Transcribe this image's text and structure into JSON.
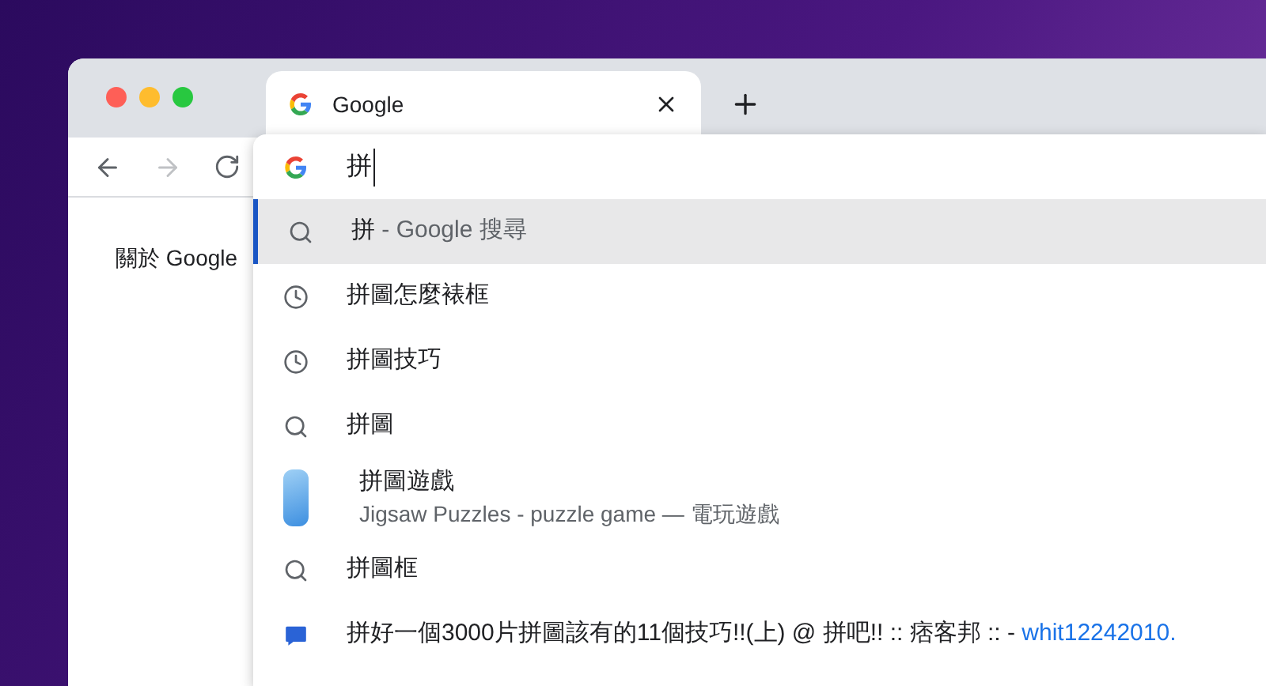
{
  "tab": {
    "title": "Google",
    "selected": true
  },
  "page": {
    "link": "關於 Google"
  },
  "omnibox": {
    "value": "拼"
  },
  "suggestions": [
    {
      "kind": "search",
      "text": "拼",
      "suffix": " - Google 搜尋",
      "selected": true
    },
    {
      "kind": "history",
      "text": "拼圖怎麼裱框",
      "selected": false
    },
    {
      "kind": "history",
      "text": "拼圖技巧",
      "selected": false
    },
    {
      "kind": "search",
      "text": "拼圖",
      "selected": false
    },
    {
      "kind": "app",
      "text": "拼圖遊戲",
      "subtitle": "Jigsaw Puzzles - puzzle game — 電玩遊戲",
      "selected": false
    },
    {
      "kind": "search",
      "text": "拼圖框",
      "selected": false
    },
    {
      "kind": "site",
      "text": "拼好一個3000片拼圖該有的11個技巧!!(上) @ 拼吧!! :: 痞客邦 :: - ",
      "url": "whit12242010.",
      "selected": false
    }
  ]
}
